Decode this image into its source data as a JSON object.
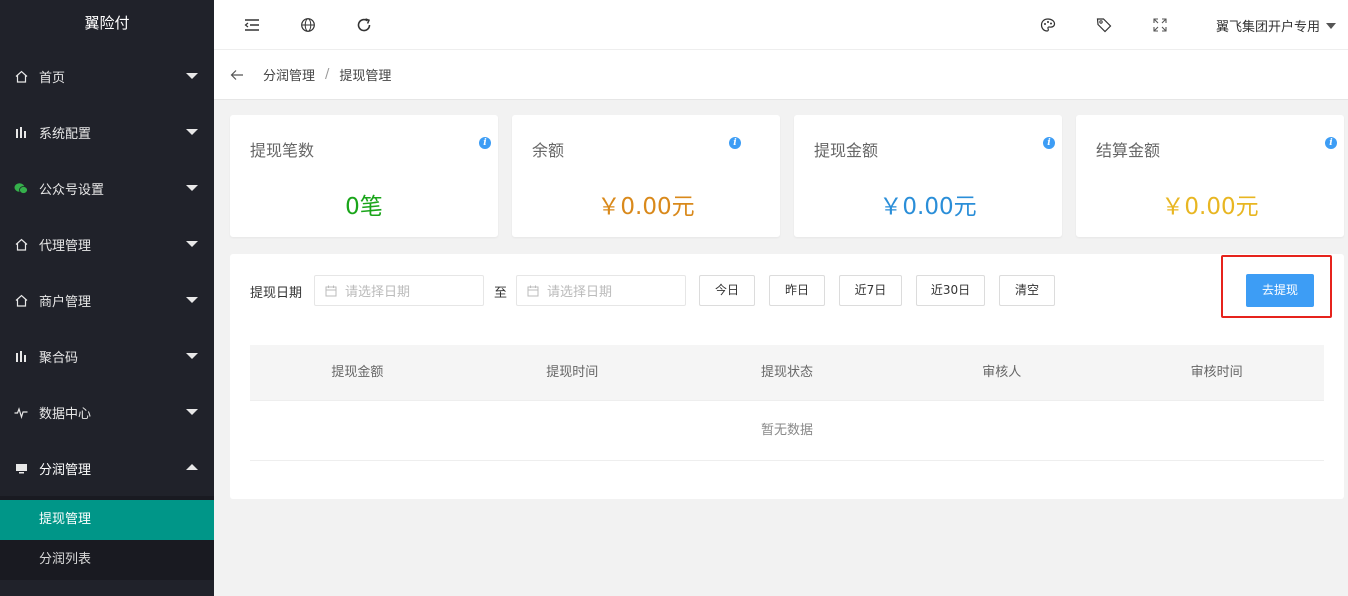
{
  "app": {
    "title": "翼险付"
  },
  "sidebar": {
    "items": [
      {
        "label": "首页",
        "icon": "home-icon"
      },
      {
        "label": "系统配置",
        "icon": "chart-icon"
      },
      {
        "label": "公众号设置",
        "icon": "wechat-icon"
      },
      {
        "label": "代理管理",
        "icon": "home-icon"
      },
      {
        "label": "商户管理",
        "icon": "home-icon"
      },
      {
        "label": "聚合码",
        "icon": "chart-icon"
      },
      {
        "label": "数据中心",
        "icon": "pulse-icon"
      },
      {
        "label": "分润管理",
        "icon": "monitor-icon"
      }
    ],
    "submenu": [
      {
        "label": "提现管理",
        "active": true
      },
      {
        "label": "分润列表",
        "active": false
      }
    ]
  },
  "header": {
    "user": "翼飞集团开户专用",
    "icons": [
      "menu-fold-icon",
      "globe-icon",
      "refresh-icon",
      "theme-icon",
      "tag-icon",
      "fullscreen-icon"
    ]
  },
  "breadcrumb": {
    "items": [
      "分润管理",
      "提现管理"
    ],
    "separator": "/"
  },
  "cards": [
    {
      "title": "提现笔数",
      "value": "0笔",
      "color": "#1aa51a"
    },
    {
      "title": "余额",
      "value": "￥0.00元",
      "color": "#d9891b"
    },
    {
      "title": "提现金额",
      "value": "￥0.00元",
      "color": "#2a8ed8"
    },
    {
      "title": "结算金额",
      "value": "￥0.00元",
      "color": "#e8b622"
    }
  ],
  "filter": {
    "date_label": "提现日期",
    "start_placeholder": "请选择日期",
    "to_label": "至",
    "end_placeholder": "请选择日期",
    "quick": [
      "今日",
      "昨日",
      "近7日",
      "近30日",
      "清空"
    ],
    "withdraw_label": "去提现"
  },
  "table": {
    "columns": [
      "提现金额",
      "提现时间",
      "提现状态",
      "审核人",
      "审核时间"
    ],
    "empty_text": "暂无数据"
  },
  "colors": {
    "sidebar_bg": "#20222a",
    "active": "#009688",
    "primary": "#3d9df5",
    "highlight": "#e6231c"
  }
}
